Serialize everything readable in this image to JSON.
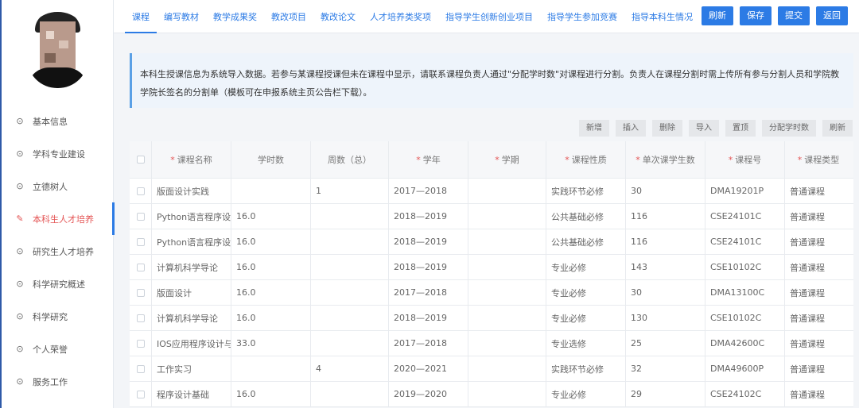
{
  "sidebar": {
    "items": [
      {
        "label": "基本信息",
        "icon": "location-pin-icon"
      },
      {
        "label": "学科专业建设",
        "icon": "location-pin-icon"
      },
      {
        "label": "立德树人",
        "icon": "location-pin-icon"
      },
      {
        "label": "本科生人才培养",
        "icon": "pen-icon",
        "active": true
      },
      {
        "label": "研究生人才培养",
        "icon": "location-pin-icon"
      },
      {
        "label": "科学研究概述",
        "icon": "location-pin-icon"
      },
      {
        "label": "科学研究",
        "icon": "location-pin-icon"
      },
      {
        "label": "个人荣誉",
        "icon": "location-pin-icon"
      },
      {
        "label": "服务工作",
        "icon": "location-pin-icon"
      }
    ]
  },
  "header": {
    "tabs": [
      "课程",
      "编写教材",
      "教学成果奖",
      "教改项目",
      "教改论文",
      "人才培养类奖项",
      "指导学生创新创业项目",
      "指导学生参加竞赛",
      "指导本科生情况"
    ],
    "active_tab": "课程",
    "actions": [
      "刷新",
      "保存",
      "提交",
      "返回"
    ]
  },
  "notice": "本科生授课信息为系统导入数据。若参与某课程授课但未在课程中显示，请联系课程负责人通过\"分配学时数\"对课程进行分割。负责人在课程分割时需上传所有参与分割人员和学院教学院长签名的分割单（模板可在申报系统主页公告栏下载）。",
  "toolbar": [
    "新增",
    "插入",
    "删除",
    "导入",
    "置顶",
    "分配学时数",
    "刷新"
  ],
  "table": {
    "headers": [
      {
        "label": "课程名称",
        "required": true
      },
      {
        "label": "学时数",
        "required": false
      },
      {
        "label": "周数（总）",
        "required": false
      },
      {
        "label": "学年",
        "required": true
      },
      {
        "label": "学期",
        "required": true
      },
      {
        "label": "课程性质",
        "required": true
      },
      {
        "label": "单次课学生数",
        "required": true
      },
      {
        "label": "课程号",
        "required": true
      },
      {
        "label": "课程类型",
        "required": true
      }
    ],
    "rows": [
      [
        "版面设计实践",
        "",
        "1",
        "2017—2018",
        "",
        "实践环节必修",
        "30",
        "DMA19201P",
        "普通课程"
      ],
      [
        "Python语言程序设计",
        "16.0",
        "",
        "2018—2019",
        "",
        "公共基础必修",
        "116",
        "CSE24101C",
        "普通课程"
      ],
      [
        "Python语言程序设计",
        "16.0",
        "",
        "2018—2019",
        "",
        "公共基础必修",
        "116",
        "CSE24101C",
        "普通课程"
      ],
      [
        "计算机科学导论",
        "16.0",
        "",
        "2018—2019",
        "",
        "专业必修",
        "143",
        "CSE10102C",
        "普通课程"
      ],
      [
        "版面设计",
        "16.0",
        "",
        "2017—2018",
        "",
        "专业必修",
        "30",
        "DMA13100C",
        "普通课程"
      ],
      [
        "计算机科学导论",
        "16.0",
        "",
        "2018—2019",
        "",
        "专业必修",
        "130",
        "CSE10102C",
        "普通课程"
      ],
      [
        "IOS应用程序设计与...",
        "33.0",
        "",
        "2017—2018",
        "",
        "专业选修",
        "25",
        "DMA42600C",
        "普通课程"
      ],
      [
        "工作实习",
        "",
        "4",
        "2020—2021",
        "",
        "实践环节必修",
        "32",
        "DMA49600P",
        "普通课程"
      ],
      [
        "程序设计基础",
        "16.0",
        "",
        "2019—2020",
        "",
        "专业必修",
        "29",
        "CSE24102C",
        "普通课程"
      ]
    ]
  }
}
